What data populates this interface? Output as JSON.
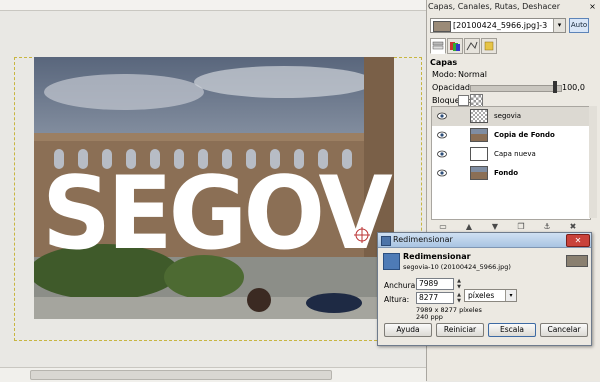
{
  "dock": {
    "title": "Capas, Canales, Rutas, Deshacer",
    "close_glyph": "×",
    "image_select": "[20100424_5966.jpg]-3",
    "auto_button": "Auto",
    "tabs": [
      "layers-tab-icon",
      "channels-tab-icon",
      "paths-tab-icon",
      "undo-tab-icon"
    ],
    "layers_header": "Capas",
    "mode_label": "Modo:",
    "mode_value": "Normal",
    "opacity_label": "Opacidad:",
    "opacity_value": "100,0",
    "opacity_fraction": 1.0,
    "lock_label": "Bloquear:",
    "layers": [
      {
        "name": "segovia",
        "selected": true,
        "thumb": "text-layer-thumb"
      },
      {
        "name": "Copia de Fondo",
        "selected": false,
        "thumb": "photo-thumb"
      },
      {
        "name": "Capa nueva",
        "selected": false,
        "thumb": "white-thumb"
      },
      {
        "name": "Fondo",
        "selected": false,
        "thumb": "photo-thumb"
      }
    ],
    "bottom_buttons": [
      "new-layer-icon",
      "raise-layer-icon",
      "lower-layer-icon",
      "duplicate-layer-icon",
      "anchor-layer-icon",
      "delete-layer-icon"
    ]
  },
  "canvas": {
    "photo_text": "SEGOVIA"
  },
  "dialog": {
    "window_title": "Redimensionar",
    "close_glyph": "✕",
    "header_title": "Redimensionar",
    "header_subtitle": "segovia-10 (20100424_5966.jpg)",
    "width_label": "Anchura:",
    "width_value": "7989",
    "height_label": "Altura:",
    "height_value": "8277",
    "units": "píxeles",
    "dims_text": "7989 x 8277 píxeles",
    "dpi_text": "240 ppp",
    "buttons": {
      "help": "Ayuda",
      "reset": "Reiniciar",
      "scale": "Escala",
      "cancel": "Cancelar"
    }
  },
  "colors": {
    "sky": "#6b7b93",
    "stone": "#8b6f55",
    "text": "#ffffff",
    "accent": "#3d6aa3"
  }
}
